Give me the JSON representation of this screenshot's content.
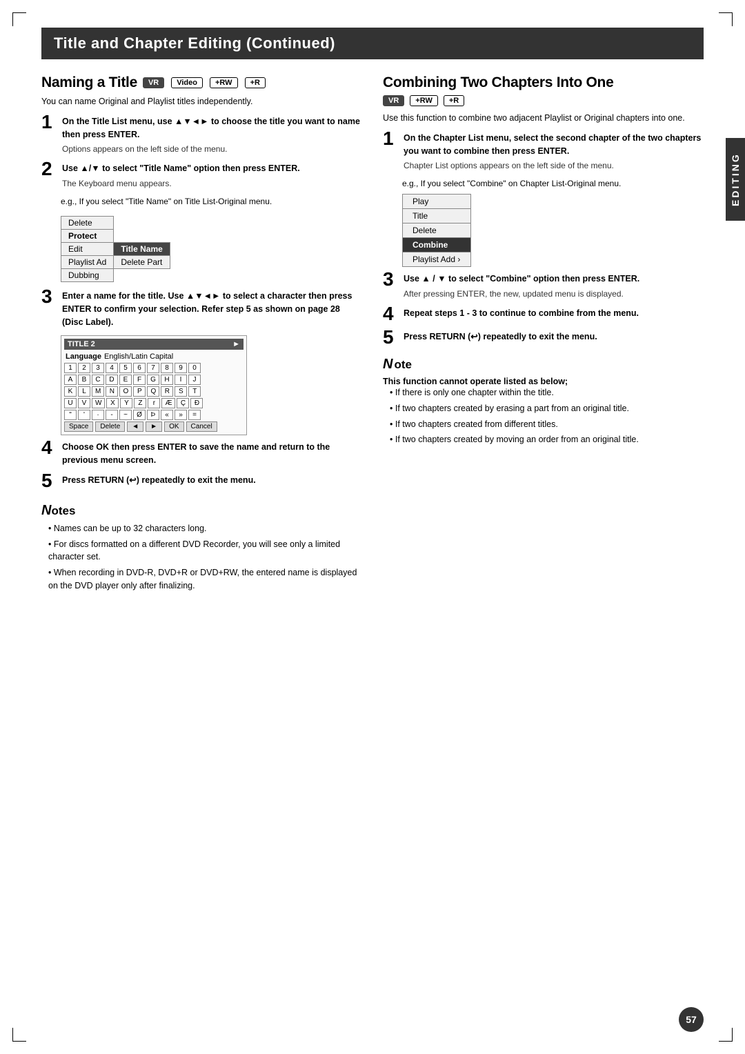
{
  "page": {
    "title": "Title and Chapter Editing (Continued)",
    "page_number": "57"
  },
  "editing_tab": "EDITING",
  "left_section": {
    "title": "Naming a Title",
    "badges": [
      "VR",
      "Video",
      "+RW",
      "+R"
    ],
    "intro": "You can name Original and Playlist titles independently.",
    "steps": [
      {
        "num": "1",
        "text": "On the Title List menu, use ▲▼◄► to choose the title you want to name then press ENTER.",
        "sub": "Options appears on the left side of the menu."
      },
      {
        "num": "2",
        "text": "Use ▲/▼ to select \"Title Name\" option then press ENTER.",
        "sub": "The Keyboard menu appears."
      },
      {
        "num": "2b",
        "text": "e.g., If you select \"Title Name\" on Title List-Original menu.",
        "sub": ""
      },
      {
        "num": "3",
        "text": "Enter a name for the title. Use ▲▼◄► to select a character then press ENTER to confirm your selection. Refer step 5 as shown on page 28 (Disc Label).",
        "sub": ""
      },
      {
        "num": "4",
        "text": "Choose OK then press ENTER to save the name and return to the previous menu screen.",
        "sub": ""
      },
      {
        "num": "5",
        "text": "Press RETURN (↩) repeatedly to exit the menu.",
        "sub": ""
      }
    ],
    "menu": {
      "rows": [
        {
          "label": "Delete",
          "highlight": false,
          "sub_cell": null
        },
        {
          "label": "Protect",
          "highlight": false,
          "sub_cell": null
        },
        {
          "label": "Edit",
          "highlight": false,
          "sub_cell": "Title Name"
        },
        {
          "label": "Playlist Ad",
          "highlight": false,
          "sub_cell": "Delete Part"
        },
        {
          "label": "Dubbing",
          "highlight": false,
          "sub_cell": null
        }
      ]
    },
    "keyboard": {
      "title": "TITLE 2",
      "language": "Language",
      "language_value": "English/Latin Capital",
      "rows": [
        [
          "1",
          "2",
          "3",
          "4",
          "5",
          "6",
          "7",
          "8",
          "9",
          "0"
        ],
        [
          "A",
          "B",
          "C",
          "D",
          "E",
          "F",
          "G",
          "H",
          "I",
          "J"
        ],
        [
          "K",
          "L",
          "M",
          "N",
          "O",
          "P",
          "Q",
          "R",
          "S",
          "T"
        ],
        [
          "U",
          "V",
          "W",
          "X",
          "Y",
          "Z",
          "r",
          "Æ",
          "Ç",
          "Ð"
        ],
        [
          "\"",
          "'",
          "·",
          "-",
          "~",
          "Ø",
          "Þ",
          "«",
          "»",
          "="
        ]
      ],
      "bottom": [
        "Space",
        "Delete",
        "◄",
        "►",
        "OK",
        "Cancel"
      ]
    },
    "notes": {
      "title": "Notes",
      "items": [
        "Names can be up to 32 characters long.",
        "For discs formatted on a different DVD Recorder, you will see only a limited character set.",
        "When recording in DVD-R, DVD+R or DVD+RW, the entered name is displayed on the DVD player only after finalizing."
      ]
    }
  },
  "right_section": {
    "title": "Combining Two Chapters Into One",
    "badges": [
      "VR",
      "+RW",
      "+R"
    ],
    "intro": "Use this function to combine two adjacent Playlist or Original chapters into one.",
    "steps": [
      {
        "num": "1",
        "text": "On the Chapter List menu, select the second chapter of the two chapters you want to combine then press ENTER.",
        "sub": "Chapter List options appears on the left side of the menu."
      },
      {
        "num": "1b",
        "text": "e.g., If you select \"Combine\" on Chapter List-Original menu.",
        "sub": ""
      },
      {
        "num": "3",
        "text": "Use ▲ / ▼ to select \"Combine\" option then press ENTER.",
        "sub": "After pressing ENTER, the new, updated menu is displayed."
      },
      {
        "num": "4",
        "text": "Repeat steps 1 - 3 to continue to combine from the menu.",
        "sub": ""
      },
      {
        "num": "5",
        "text": "Press RETURN (↩) repeatedly to exit the menu.",
        "sub": ""
      }
    ],
    "menu": {
      "rows": [
        {
          "label": "Play",
          "highlight": false
        },
        {
          "label": "Title",
          "highlight": false
        },
        {
          "label": "Delete",
          "highlight": false
        },
        {
          "label": "Combine",
          "highlight": true
        },
        {
          "label": "Playlist Add",
          "highlight": false,
          "arrow": true
        }
      ]
    },
    "notes": {
      "title": "Note",
      "bold_title": "This function cannot operate listed as below;",
      "items": [
        "If there is only one chapter within the title.",
        "If two chapters created by erasing a part from an original title.",
        "If two chapters created from different titles.",
        "If two chapters created by moving an order from an original title."
      ]
    }
  }
}
